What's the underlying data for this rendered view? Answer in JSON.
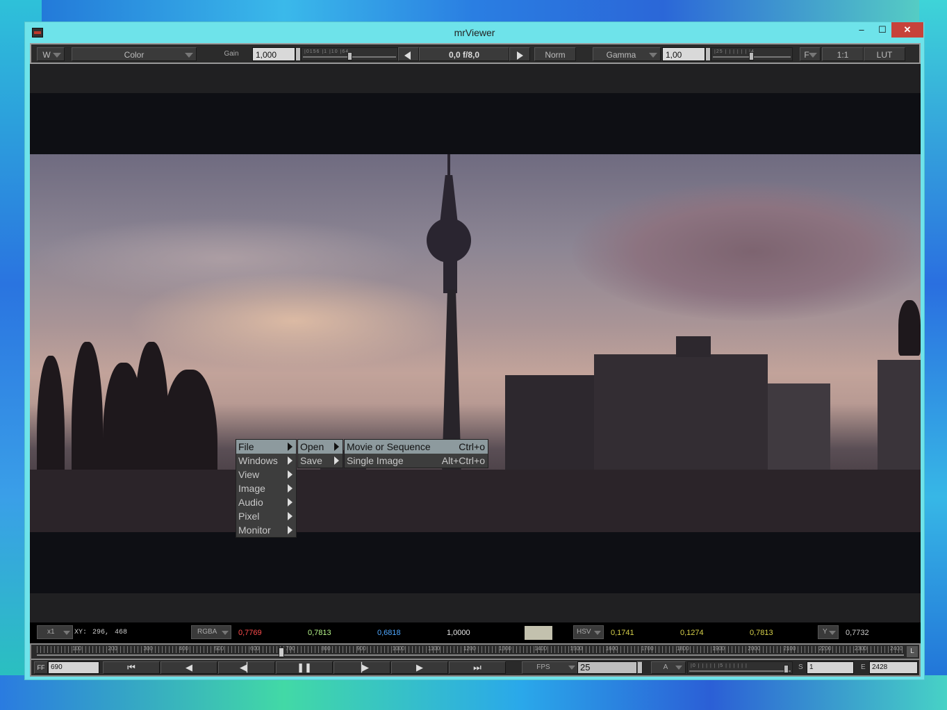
{
  "window": {
    "title": "mrViewer",
    "min": "–",
    "max": "☐",
    "close": "✕"
  },
  "toolbar": {
    "w_button": "W",
    "channel": "Color",
    "gain_label": "Gain",
    "gain_value": "1,000",
    "gain_ticks": "|0156 |1        |10  |64",
    "fstop": "0,0  f/8,0",
    "norm": "Norm",
    "gamma_label": "Gamma",
    "gamma_value": "1,00",
    "gamma_ticks": "|25  |  |  |  |  |  |  |4",
    "f_button": "F",
    "ratio": "1:1",
    "lut": "LUT"
  },
  "context_menu": {
    "main": [
      "File",
      "Windows",
      "View",
      "Image",
      "Audio",
      "Pixel",
      "Monitor"
    ],
    "file_sub": [
      "Open",
      "Save"
    ],
    "open_sub": [
      {
        "label": "Movie or Sequence",
        "shortcut": "Ctrl+o"
      },
      {
        "label": "Single Image",
        "shortcut": "Alt+Ctrl+o"
      }
    ]
  },
  "infobar": {
    "zoom": "x1",
    "xy_label": "XY:",
    "x": "296,",
    "y": "468",
    "rgba_mode": "RGBA",
    "r": "0,7769",
    "g": "0,7813",
    "b": "0,6818",
    "a": "1,0000",
    "hsv_mode": "HSV",
    "h": "0,1741",
    "s": "0,1274",
    "v": "0,7813",
    "y_mode": "Y",
    "lum": "0,7732",
    "colors": {
      "r": "#ff4d4d",
      "g": "#b6f58a",
      "b": "#4fa8ff",
      "a": "#e6e6e6",
      "hsv": "#d7d14a",
      "lum": "#cccccc",
      "swatch": "#c3c1ae"
    }
  },
  "timeline": {
    "labels": [
      "100",
      "200",
      "300",
      "400",
      "500",
      "600",
      "700",
      "800",
      "900",
      "1000",
      "1100",
      "1200",
      "1300",
      "1400",
      "1500",
      "1600",
      "1700",
      "1800",
      "1900",
      "2000",
      "2100",
      "2200",
      "2300",
      "2400"
    ],
    "loop_label": "L"
  },
  "controls": {
    "frame_mode": "FF",
    "frame": "690",
    "fps_label": "FPS",
    "fps": "25",
    "audio": "A",
    "vol_ticks": "|0 |  |  |  |  |  |5 |  |  |  |  |  |",
    "start_label": "S",
    "start": "1",
    "end_label": "E",
    "end": "2428",
    "icons": [
      "skip-start-icon",
      "step-back-icon",
      "play-backward-icon",
      "pause-icon",
      "play-forward-icon",
      "step-forward-icon",
      "skip-end-icon"
    ]
  }
}
